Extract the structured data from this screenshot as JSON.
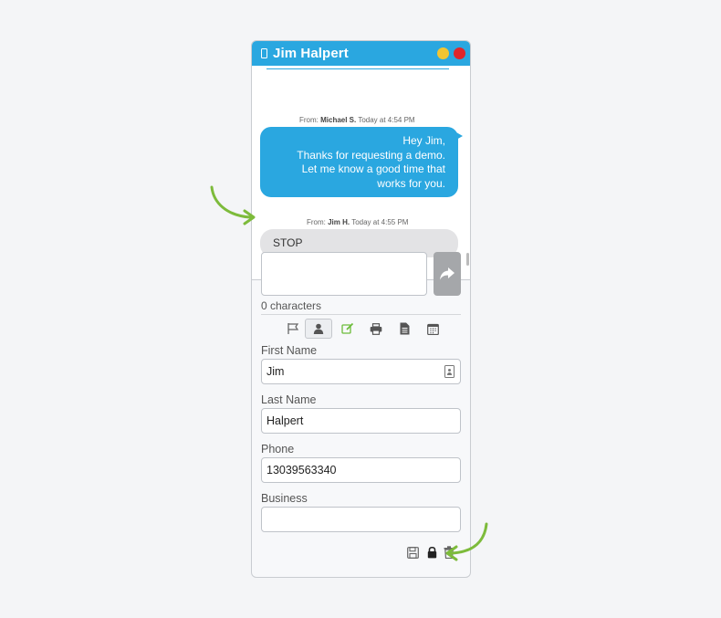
{
  "window": {
    "title": "Jim Halpert",
    "title_icon": "mobile-phone-icon",
    "controls": [
      "minimize-dot",
      "close-dot"
    ]
  },
  "messages": [
    {
      "meta_prefix": "From: ",
      "sender": "Michael S.",
      "time": " Today at 4:54 PM",
      "direction": "outgoing",
      "lines": [
        "Hey Jim,",
        "Thanks for requesting a demo.",
        "Let me know a good time that",
        "works for you."
      ]
    },
    {
      "meta_prefix": "From: ",
      "sender": "Jim H.",
      "time": " Today at 4:55 PM",
      "direction": "incoming",
      "text": "STOP"
    }
  ],
  "compose": {
    "value": "",
    "char_count": "0 characters",
    "send_icon": "share-arrow-icon"
  },
  "toolbar": {
    "icons": [
      "flag-icon",
      "person-icon",
      "edit-icon",
      "print-icon",
      "document-icon",
      "calendar-icon"
    ],
    "active": "person-icon"
  },
  "form": {
    "first_name_label": "First Name",
    "first_name_value": "Jim",
    "last_name_label": "Last Name",
    "last_name_value": "Halpert",
    "phone_label": "Phone",
    "phone_value": "13039563340",
    "business_label": "Business",
    "business_value": ""
  },
  "footer": {
    "icons": [
      "save-icon",
      "lock-icon",
      "trash-icon"
    ]
  },
  "colors": {
    "accent": "#2aa7e0",
    "annotation_arrow": "#7dbb3b",
    "minimize": "#f2c531",
    "close": "#e0262b"
  }
}
